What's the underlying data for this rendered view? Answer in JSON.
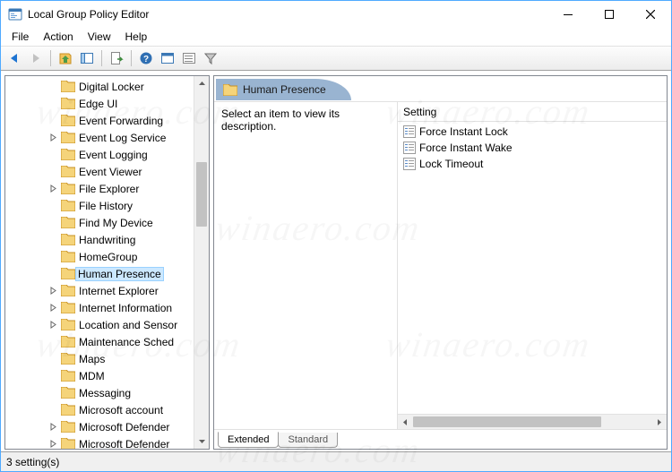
{
  "window": {
    "title": "Local Group Policy Editor"
  },
  "menu": {
    "file": "File",
    "action": "Action",
    "view": "View",
    "help": "Help"
  },
  "tree": {
    "items": [
      {
        "label": "Digital Locker",
        "expandable": false
      },
      {
        "label": "Edge UI",
        "expandable": false
      },
      {
        "label": "Event Forwarding",
        "expandable": false
      },
      {
        "label": "Event Log Service",
        "expandable": true
      },
      {
        "label": "Event Logging",
        "expandable": false
      },
      {
        "label": "Event Viewer",
        "expandable": false
      },
      {
        "label": "File Explorer",
        "expandable": true
      },
      {
        "label": "File History",
        "expandable": false
      },
      {
        "label": "Find My Device",
        "expandable": false
      },
      {
        "label": "Handwriting",
        "expandable": false
      },
      {
        "label": "HomeGroup",
        "expandable": false
      },
      {
        "label": "Human Presence",
        "expandable": false,
        "selected": true
      },
      {
        "label": "Internet Explorer",
        "expandable": true
      },
      {
        "label": "Internet Information",
        "expandable": true
      },
      {
        "label": "Location and Sensor",
        "expandable": true
      },
      {
        "label": "Maintenance Sched",
        "expandable": false
      },
      {
        "label": "Maps",
        "expandable": false
      },
      {
        "label": "MDM",
        "expandable": false
      },
      {
        "label": "Messaging",
        "expandable": false
      },
      {
        "label": "Microsoft account",
        "expandable": false
      },
      {
        "label": "Microsoft Defender ",
        "expandable": true
      },
      {
        "label": "Microsoft Defender ",
        "expandable": true
      }
    ]
  },
  "details": {
    "heading": "Human Presence",
    "description": "Select an item to view its description.",
    "column_header": "Setting",
    "settings": [
      {
        "label": "Force Instant Lock"
      },
      {
        "label": "Force Instant Wake"
      },
      {
        "label": "Lock Timeout"
      }
    ]
  },
  "tabs": {
    "extended": "Extended",
    "standard": "Standard"
  },
  "status": {
    "text": "3 setting(s)"
  },
  "watermark": "winaero.com"
}
